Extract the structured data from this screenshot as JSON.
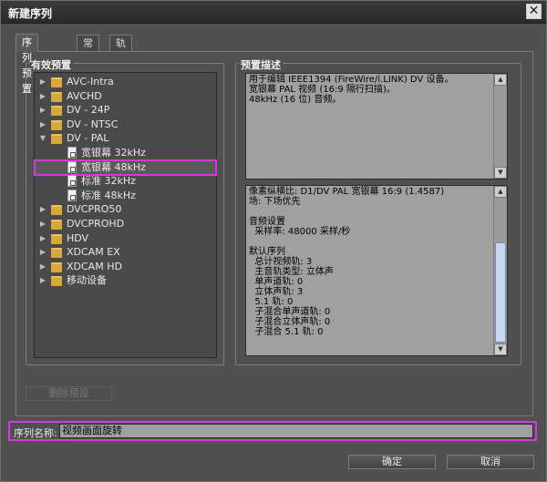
{
  "window": {
    "title": "新建序列"
  },
  "tabs": [
    {
      "label": "序列预置"
    },
    {
      "label": "常规"
    },
    {
      "label": "轨道"
    }
  ],
  "presets": {
    "heading": "有效预置",
    "tree": [
      {
        "label": "AVC-Intra",
        "type": "folder",
        "expanded": false
      },
      {
        "label": "AVCHD",
        "type": "folder",
        "expanded": false
      },
      {
        "label": "DV - 24P",
        "type": "folder",
        "expanded": false
      },
      {
        "label": "DV - NTSC",
        "type": "folder",
        "expanded": false
      },
      {
        "label": "DV - PAL",
        "type": "folder",
        "expanded": true
      },
      {
        "label": "宽银幕 32kHz",
        "type": "preset"
      },
      {
        "label": "宽银幕 48kHz",
        "type": "preset",
        "selected": true
      },
      {
        "label": "标准 32kHz",
        "type": "preset"
      },
      {
        "label": "标准 48kHz",
        "type": "preset"
      },
      {
        "label": "DVCPRO50",
        "type": "folder",
        "expanded": false
      },
      {
        "label": "DVCPROHD",
        "type": "folder",
        "expanded": false
      },
      {
        "label": "HDV",
        "type": "folder",
        "expanded": false
      },
      {
        "label": "XDCAM EX",
        "type": "folder",
        "expanded": false
      },
      {
        "label": "XDCAM HD",
        "type": "folder",
        "expanded": false
      },
      {
        "label": "移动设备",
        "type": "folder",
        "expanded": false
      }
    ],
    "delete_button": "删除预设"
  },
  "description": {
    "heading": "预置描述",
    "summary": "用于编辑 IEEE1394 (FireWire/i.LINK) DV 设备。\n宽银幕 PAL 视频 (16:9 隔行扫描)。\n48kHz (16 位) 音频。",
    "details": "像素纵横比: D1/DV PAL 宽银幕 16:9 (1.4587)\n场: 下场优先\n\n音频设置\n  采样率: 48000 采样/秒\n\n默认序列\n  总计视频轨: 3\n  主音轨类型: 立体声\n  单声道轨: 0\n  立体声轨: 3\n  5.1 轨: 0\n  子混合单声道轨: 0\n  子混合立体声轨: 0\n  子混合 5.1 轨: 0"
  },
  "sequence_name": {
    "label": "序列名称:",
    "value": "视频画面旋转"
  },
  "buttons": {
    "ok": "确定",
    "cancel": "取消"
  },
  "colors": {
    "highlight": "#d838d8",
    "panel_bg": "#505050",
    "text_bg": "#a0a0a0"
  }
}
